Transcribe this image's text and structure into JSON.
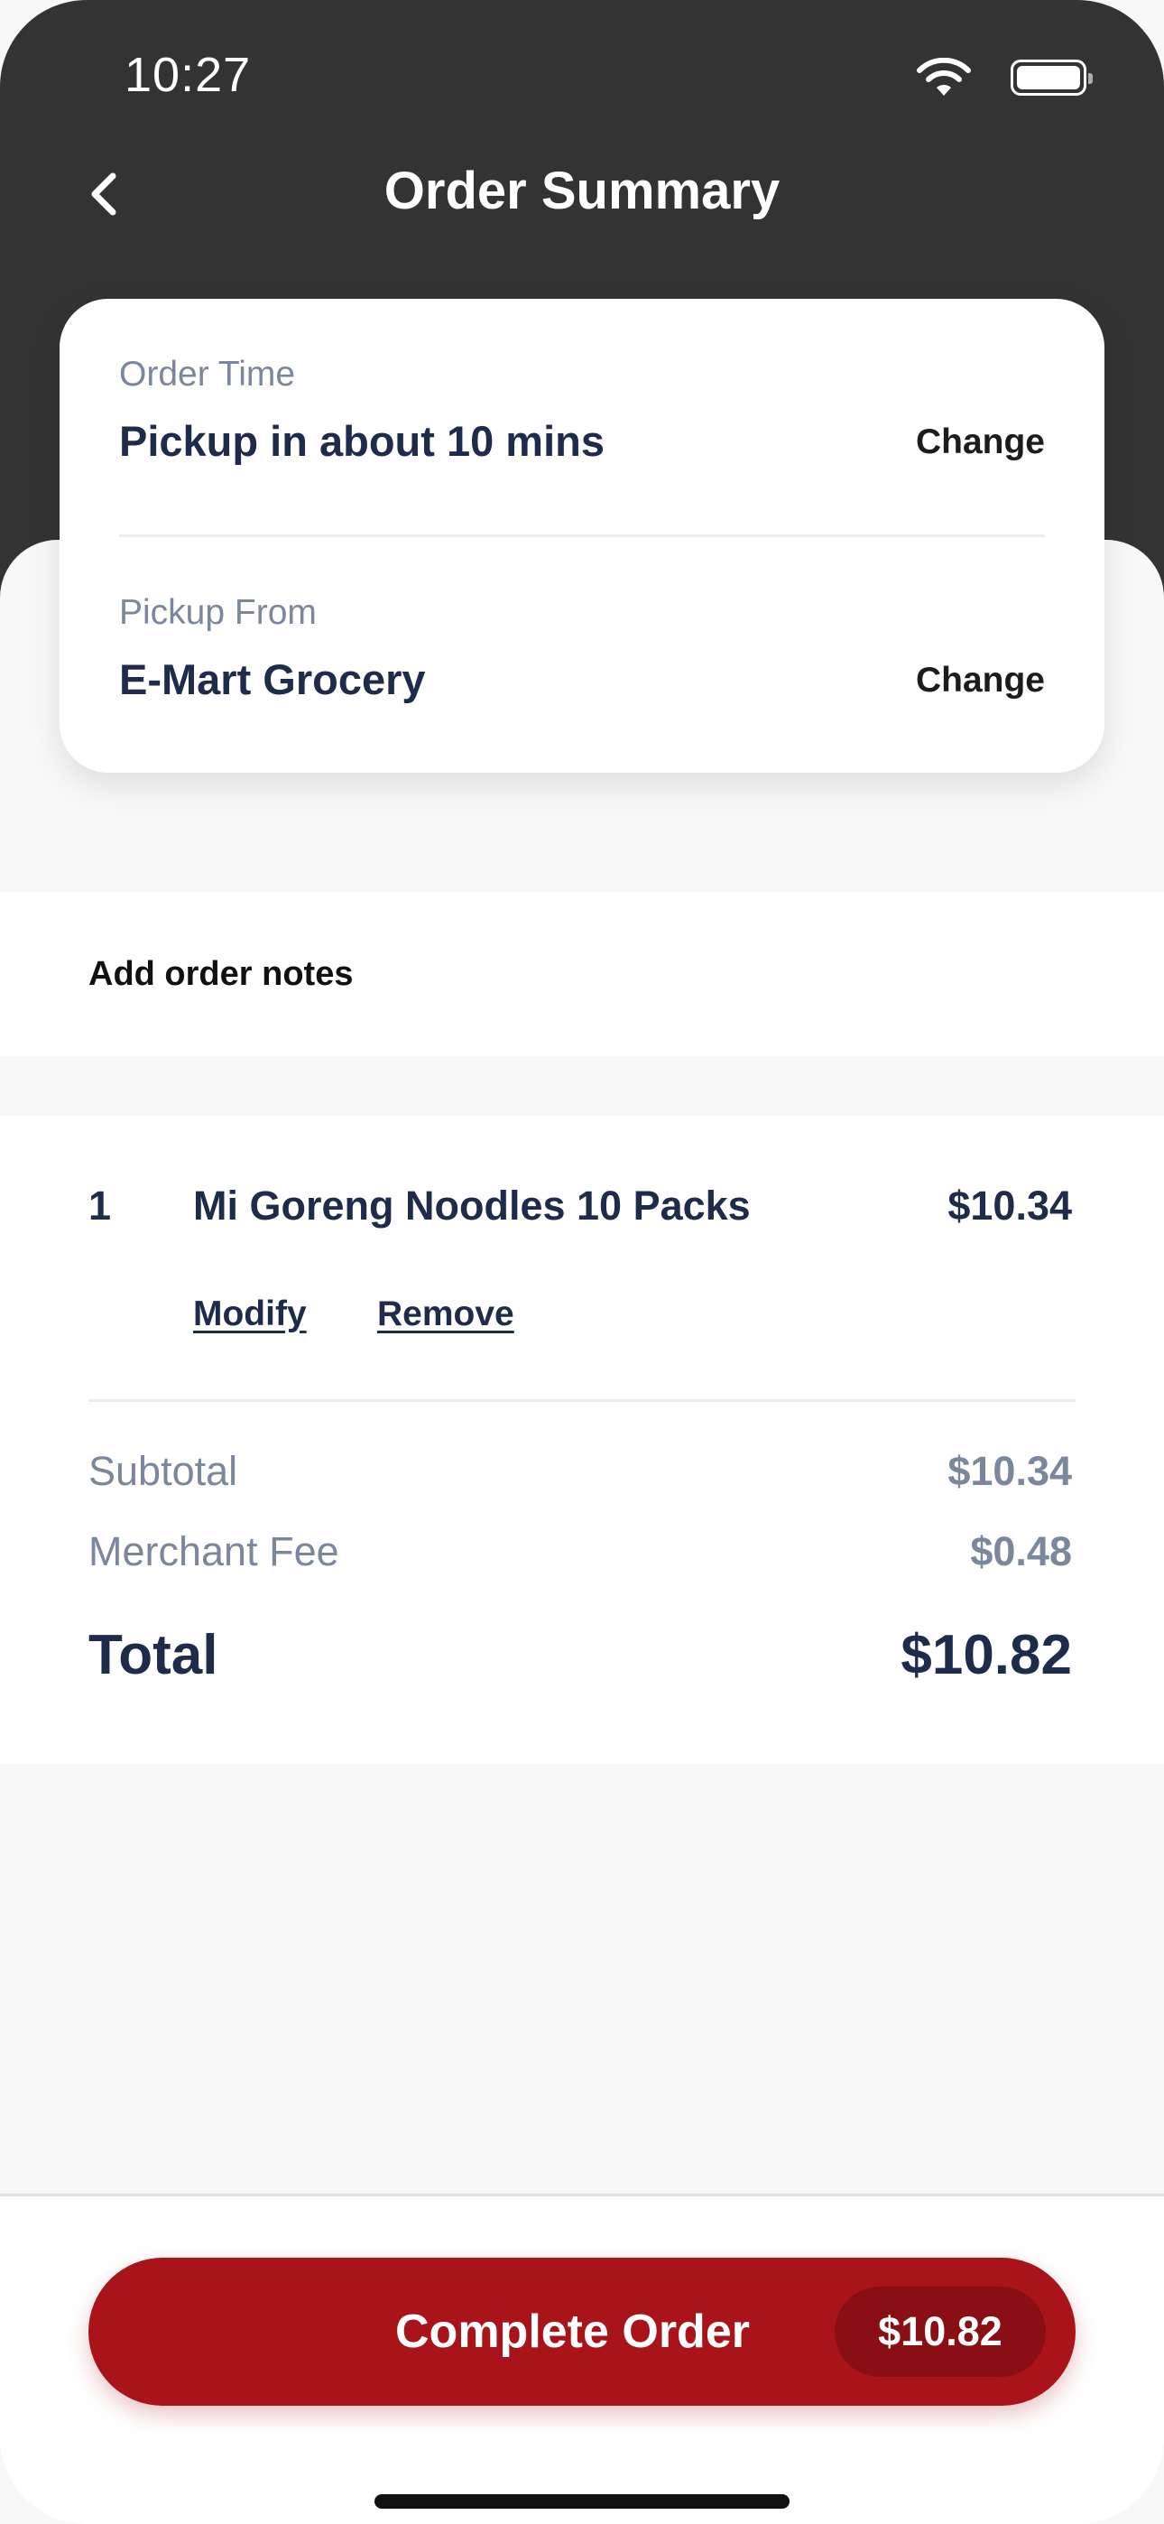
{
  "status_bar": {
    "time": "10:27",
    "wifi_icon": "wifi-icon",
    "battery_icon": "battery-icon"
  },
  "header": {
    "back_icon": "chevron-left-icon",
    "title": "Order Summary"
  },
  "order_card": {
    "order_time": {
      "label": "Order Time",
      "value": "Pickup in about 10 mins",
      "action": "Change"
    },
    "pickup": {
      "label": "Pickup From",
      "value": "E-Mart Grocery",
      "action": "Change"
    }
  },
  "notes": {
    "label": "Add order notes"
  },
  "items": [
    {
      "qty": "1",
      "name": "Mi Goreng Noodles 10 Packs",
      "price": "$10.34",
      "modify_label": "Modify",
      "remove_label": "Remove"
    }
  ],
  "summary": {
    "subtotal_label": "Subtotal",
    "subtotal_value": "$10.34",
    "fee_label": "Merchant Fee",
    "fee_value": "$0.48",
    "total_label": "Total",
    "total_value": "$10.82"
  },
  "footer": {
    "cta_label": "Complete Order",
    "cta_amount": "$10.82"
  },
  "colors": {
    "header_bg": "#333333",
    "text_primary": "#1e2b4a",
    "text_muted": "#7a879c",
    "cta_red": "#a8141a"
  }
}
